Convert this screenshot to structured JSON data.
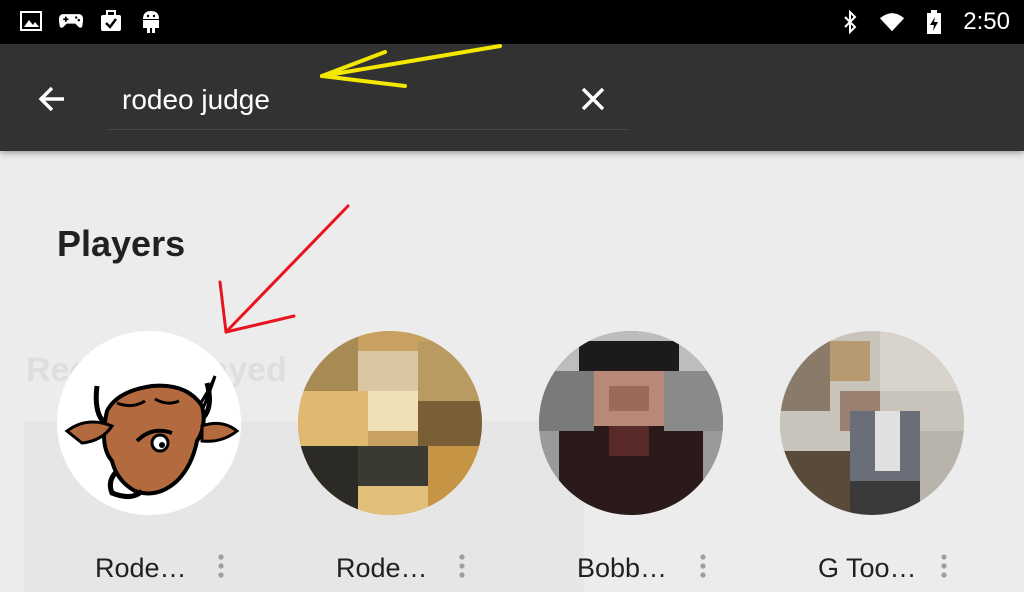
{
  "status_bar": {
    "left_icons": [
      "image-icon",
      "gamepad-icon",
      "briefcase-check-icon",
      "android-icon"
    ],
    "right_icons": [
      "bluetooth-icon",
      "wifi-icon",
      "battery-icon"
    ],
    "time": "2:50"
  },
  "toolbar": {
    "back_icon": "arrow-left-icon",
    "search_value": "rodeo judge",
    "clear_icon": "close-icon"
  },
  "players_section": {
    "title": "Players",
    "faded_label": "Recently Played",
    "items": [
      {
        "name": "Rode…",
        "avatar": "bull-logo"
      },
      {
        "name": "Rode…",
        "avatar": "pixelated-photo"
      },
      {
        "name": "Bobb…",
        "avatar": "pixelated-photo"
      },
      {
        "name": "G Too…",
        "avatar": "pixelated-photo"
      }
    ]
  },
  "colors": {
    "status_bar": "#000000",
    "toolbar": "#323232",
    "background": "#ececec",
    "annotation_yellow": "#f5e800",
    "annotation_red": "#e8141e"
  }
}
